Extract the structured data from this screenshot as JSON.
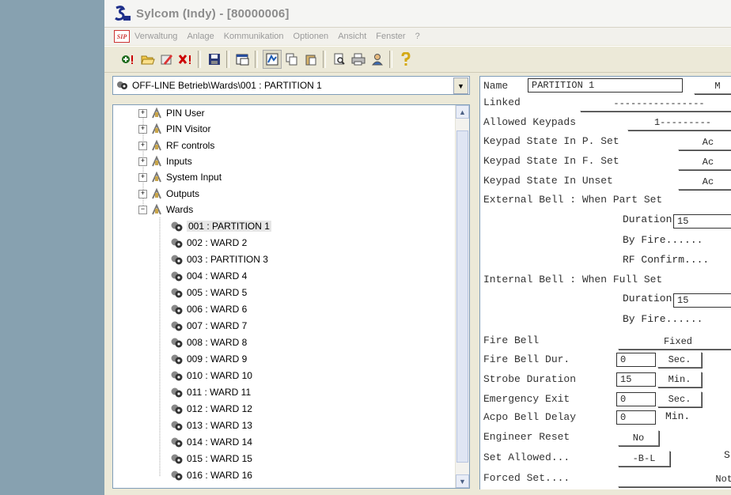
{
  "window": {
    "title": "Sylcom (Indy) - [80000006]"
  },
  "menubar": {
    "logo_text": "SIP",
    "items": [
      "Verwaltung",
      "Anlage",
      "Kommunikation",
      "Optionen",
      "Ansicht",
      "Fenster",
      "?"
    ]
  },
  "toolbar": {
    "buttons": [
      "add-icon",
      "open-folder-icon",
      "edit-icon",
      "delete-icon",
      "save-icon",
      "properties-icon",
      "view-icon",
      "copy-icon",
      "paste-icon",
      "print-preview-icon",
      "print-icon",
      "user-icon",
      "help-icon"
    ]
  },
  "leftpane": {
    "combo_value": "OFF-LINE Betrieb\\Wards\\001 : PARTITION 1",
    "tree": {
      "groups": [
        {
          "label": "PIN User",
          "expander": "+"
        },
        {
          "label": "PIN Visitor",
          "expander": "+"
        },
        {
          "label": "RF controls",
          "expander": "+"
        },
        {
          "label": "Inputs",
          "expander": "+"
        },
        {
          "label": "System Input",
          "expander": "+"
        },
        {
          "label": "Outputs",
          "expander": "+"
        },
        {
          "label": "Wards",
          "expander": "−"
        }
      ],
      "wards": [
        "001 : PARTITION 1",
        "002 : WARD  2",
        "003 : PARTITION 3",
        "004 : WARD  4",
        "005 : WARD  5",
        "006 : WARD  6",
        "007 : WARD  7",
        "008 : WARD  8",
        "009 : WARD  9",
        "010 : WARD  10",
        "011 : WARD  11",
        "012 : WARD  12",
        "013 : WARD  13",
        "014 : WARD  14",
        "015 : WARD  15",
        "016 : WARD  16"
      ]
    }
  },
  "detail": {
    "name_label": "Name",
    "name_value": "PARTITION 1",
    "name_button": "M",
    "linked_label": "Linked",
    "linked_value": "----------------",
    "allowed_keypads_label": "Allowed Keypads",
    "allowed_keypads_value": "1---------",
    "keypad_pset_label": "Keypad State In P. Set",
    "keypad_pset_value": "Ac",
    "keypad_fset_label": "Keypad State In F. Set",
    "keypad_fset_value": "Ac",
    "keypad_unset_label": "Keypad State In Unset",
    "keypad_unset_value": "Ac",
    "external_bell_label": "External Bell : When Part Set",
    "ext_duration_label": "Duration",
    "ext_duration_value": "15",
    "ext_by_fire": "By Fire......",
    "ext_rf_confirm": "RF Confirm....",
    "internal_bell_label": "Internal Bell : When Full Set",
    "int_duration_label": "Duration",
    "int_duration_value": "15",
    "int_by_fire": "By Fire......",
    "fire_bell_label": "Fire Bell",
    "fire_bell_value": "Fixed",
    "fire_bell_dur_label": "Fire Bell Dur.",
    "fire_bell_dur_value": "0",
    "fire_bell_dur_unit": "Sec.",
    "strobe_duration_label": "Strobe Duration",
    "strobe_duration_value": "15",
    "strobe_duration_unit": "Min.",
    "emergency_exit_label": "Emergency Exit",
    "emergency_exit_value": "0",
    "emergency_exit_unit": "Sec.",
    "acpo_bell_delay_label": "Acpo Bell Delay",
    "acpo_bell_delay_value": "0",
    "acpo_bell_delay_unit": "Min.",
    "engineer_reset_label": "Engineer Reset",
    "engineer_reset_value": "No",
    "set_allowed_label": "Set Allowed...",
    "set_allowed_value": "-B-L",
    "set_allowed_trailing": "S",
    "forced_set_label": "Forced Set....",
    "forced_set_value": "Not"
  },
  "colors": {
    "background_strip": "#87a1b0",
    "window_face": "#ece9d8",
    "selection": "#e6e6e6",
    "border": "#7f9db9"
  }
}
